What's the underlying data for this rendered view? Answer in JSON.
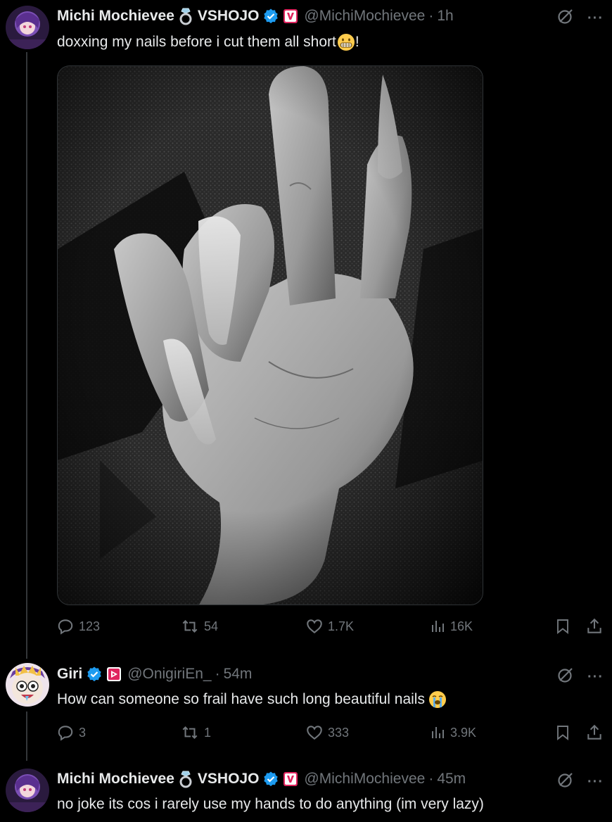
{
  "tweets": [
    {
      "name": "Michi Mochievee",
      "org": "VSHOJO",
      "handle": "@MichiMochievee",
      "time": "1h",
      "text": "doxxing my nails before i cut them all short",
      "text_suffix": "!",
      "emoji": "grimacing-face",
      "stats": {
        "replies": "123",
        "reposts": "54",
        "likes": "1.7K",
        "views": "16K"
      }
    },
    {
      "name": "Giri",
      "handle": "@OnigiriEn_",
      "time": "54m",
      "text": "How can someone so frail have such long beautiful nails",
      "emoji": "loudly-crying-face",
      "stats": {
        "replies": "3",
        "reposts": "1",
        "likes": "333",
        "views": "3.9K"
      }
    },
    {
      "name": "Michi Mochievee",
      "org": "VSHOJO",
      "handle": "@MichiMochievee",
      "time": "45m",
      "text": "no joke its cos i rarely use my hands to do anything (im very lazy)"
    }
  ],
  "separator": "·",
  "more_label": "···",
  "colors": {
    "verified": "#1d9bf0",
    "vshojo_badge": "#e0245e",
    "muted": "#71767b",
    "text": "#e7e9ea"
  }
}
